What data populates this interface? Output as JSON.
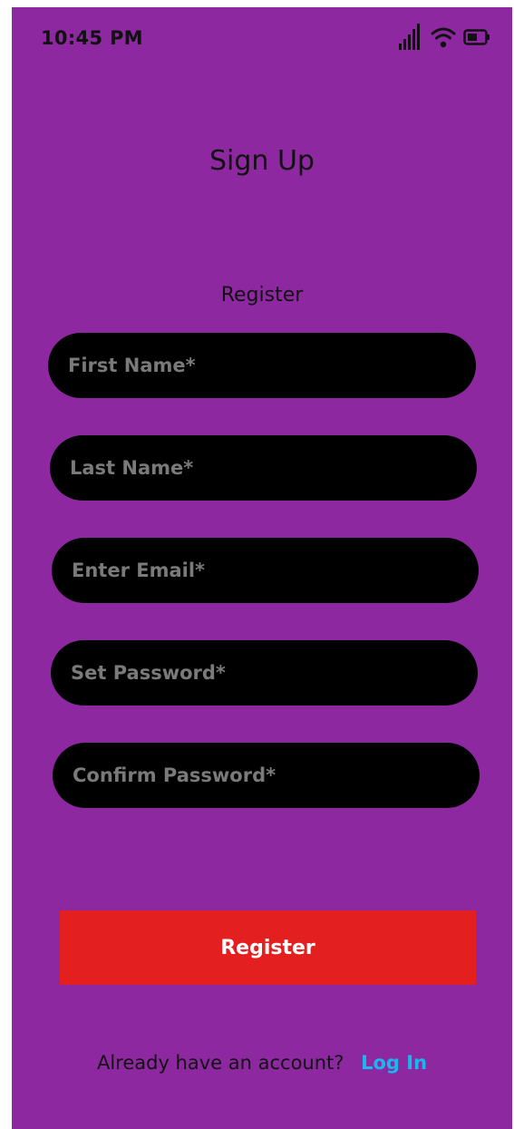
{
  "status_bar": {
    "time": "10:45 PM",
    "icons": [
      "signal-icon",
      "wifi-icon",
      "battery-icon"
    ]
  },
  "header": {
    "title": "Sign Up",
    "subtitle": "Register"
  },
  "form": {
    "first_name_placeholder": "First Name*",
    "last_name_placeholder": "Last Name*",
    "email_placeholder": "Enter Email*",
    "password_placeholder": "Set Password*",
    "confirm_password_placeholder": "Confirm Password*",
    "submit_label": "Register"
  },
  "footer": {
    "prompt": "Already have an account?",
    "login_label": "Log In"
  },
  "colors": {
    "background": "#8e28a0",
    "field_background": "#000000",
    "button": "#e31f1f",
    "link": "#1ab6ef"
  }
}
